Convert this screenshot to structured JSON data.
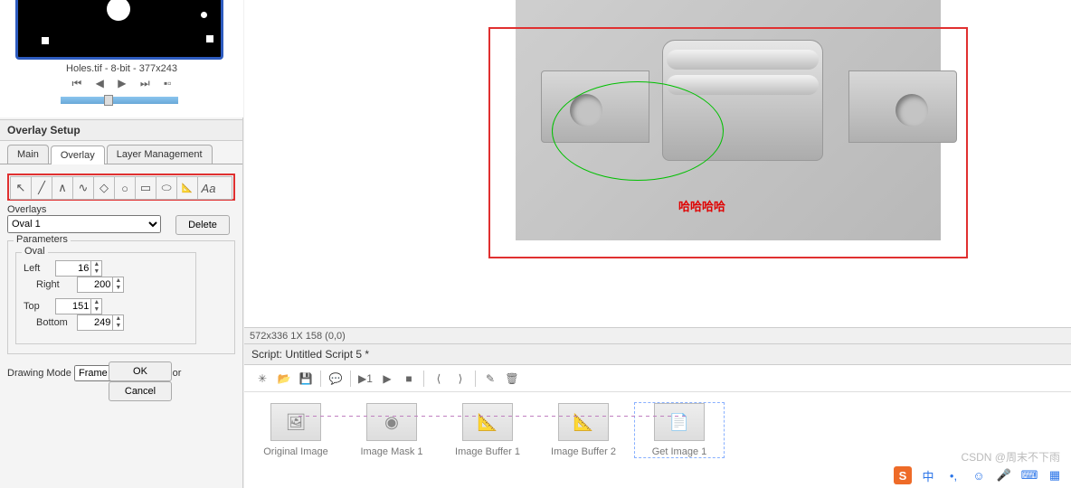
{
  "thumbnail": {
    "label": "Holes.tif - 8-bit - 377x243"
  },
  "overlay_setup": {
    "header": "Overlay Setup",
    "tabs": {
      "main": "Main",
      "overlay": "Overlay",
      "layer": "Layer Management"
    },
    "overlays_label": "Overlays",
    "overlays_selected": "Oval 1",
    "delete_btn": "Delete",
    "parameters_label": "Parameters",
    "oval_label": "Oval",
    "left_label": "Left",
    "left_val": "16",
    "right_label": "Right",
    "right_val": "200",
    "top_label": "Top",
    "top_val": "151",
    "bottom_label": "Bottom",
    "bottom_val": "249",
    "drawing_mode_label": "Drawing Mode",
    "drawing_mode_val": "Frame",
    "color_label": "Color",
    "ok_btn": "OK",
    "cancel_btn": "Cancel"
  },
  "canvas": {
    "annotation_text": "哈哈哈哈",
    "status": "572x336 1X 158   (0,0)"
  },
  "script": {
    "title": "Script: Untitled Script 5 *",
    "nodes": [
      "Original Image",
      "Image Mask 1",
      "Image Buffer 1",
      "Image Buffer 2",
      "Get Image 1"
    ]
  },
  "watermark": "CSDN @周末不下雨",
  "ime": {
    "zhong": "中",
    "dot": "•,",
    "smile": "☺",
    "mic": "🎤",
    "kb": "⌨",
    "grid": "▦"
  }
}
